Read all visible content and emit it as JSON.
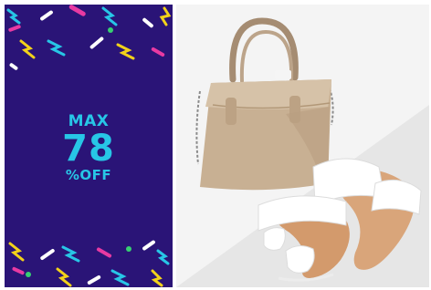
{
  "promo": {
    "line1": "MAX",
    "line2": "78",
    "line3": "%OFF",
    "background_color": "#2a1477",
    "text_color": "#27c6e6",
    "confetti_colors": [
      "#f2d21a",
      "#e83aa2",
      "#27c6e6",
      "#ffffff",
      "#37d072"
    ]
  },
  "product_image": {
    "items": [
      "handbag-icon",
      "sandals-icon"
    ]
  }
}
